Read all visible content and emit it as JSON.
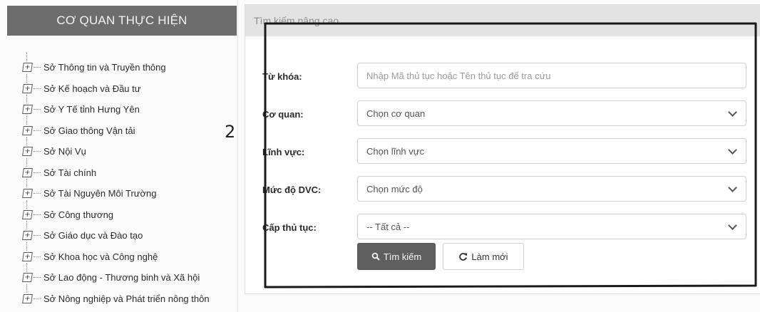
{
  "sidebar": {
    "title": "CƠ QUAN THỰC HIỆN",
    "items": [
      {
        "label": "Sở Thông tin và Truyền thông"
      },
      {
        "label": "Sở Kế hoạch và Đầu tư"
      },
      {
        "label": "Sở Y Tế tỉnh Hưng Yên"
      },
      {
        "label": "Sở Giao thông Vận tải"
      },
      {
        "label": "Sở Nội Vụ"
      },
      {
        "label": "Sở Tài chính"
      },
      {
        "label": "Sở Tài Nguyên Môi Trường"
      },
      {
        "label": "Sở Công thương"
      },
      {
        "label": "Sở Giáo dục và Đào tạo"
      },
      {
        "label": "Sở Khoa học và Công nghệ"
      },
      {
        "label": "Sở Lao động - Thương binh và Xã hội"
      },
      {
        "label": "Sở Nông nghiệp và Phát triển nông thôn"
      }
    ],
    "expand_icon": "plus-box-icon"
  },
  "annotation": {
    "number": "2"
  },
  "search_panel": {
    "title": "Tìm kiếm nâng cao",
    "fields": {
      "keyword": {
        "label": "Từ khóa:",
        "value": "",
        "placeholder": "Nhập Mã thủ tục hoặc Tên thủ tục để tra cứu"
      },
      "agency": {
        "label": "Cơ quan:",
        "selected": "Chọn cơ quan"
      },
      "field": {
        "label": "Lĩnh vực:",
        "selected": "Chọn lĩnh vực"
      },
      "service_level": {
        "label": "Mức độ DVC:",
        "selected": "Chọn mức độ"
      },
      "procedure_level": {
        "label": "Cấp thủ tục:",
        "selected": "-- Tất cả --"
      }
    },
    "buttons": {
      "search_label": "Tìm kiếm",
      "reset_label": "Làm mới"
    }
  },
  "colors": {
    "sidebar_header_bg": "#6d6d6d",
    "panel_header_bg": "#e3e3e3",
    "search_button_bg": "#5f5f5f"
  }
}
